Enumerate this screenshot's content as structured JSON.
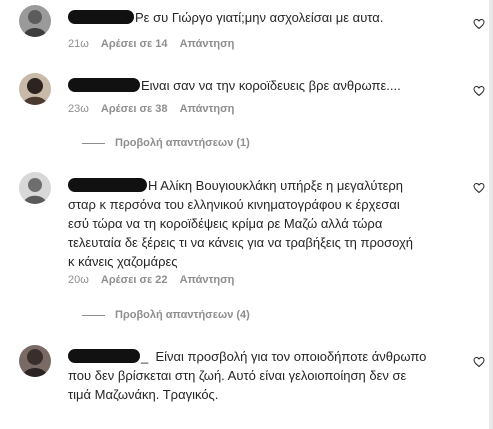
{
  "comments": [
    {
      "text": "Ρε συ Γιώργο γιατί;μην ασχολείσαι με αυτα.",
      "time": "21ω",
      "likes": "Αρέσει σε 14",
      "reply": "Απάντηση"
    },
    {
      "text": "Ειναι σαν να την κοροϊδευεις βρε ανθρωπε....",
      "time": "23ω",
      "likes": "Αρέσει σε 38",
      "reply": "Απάντηση",
      "view_replies": "Προβολή απαντήσεων (1)"
    },
    {
      "line1": "Η Αλίκη Βουγιουκλάκη υπήρξε η μεγαλύτερη",
      "line2": "σταρ κ περσόνα του ελληνικού κινηματογράφου κ έρχεσαι",
      "line3": "εσύ τώρα να τη κοροϊδέψεις κρίμα ρε Μαζώ αλλά τώρα",
      "line4": "τελευταία δε ξέρεις τι να κάνεις για να τραβήξεις τη προσοχή",
      "line5": "κ κάνεις χαζομάρες",
      "time": "20ω",
      "likes": "Αρέσει σε 22",
      "reply": "Απάντηση",
      "view_replies": "Προβολή απαντήσεων (4)"
    },
    {
      "prefix": "_",
      "line1": "Είναι προσβολή για τον οποιοδήποτε άνθρωπο",
      "line2": "που δεν βρίσκεται στη ζωή. Αυτό είναι γελοιοποίηση δεν σε",
      "line3": "τιμά Μαζωνάκη. Τραγικός."
    }
  ],
  "icons": {
    "like": "heart-outline-icon"
  },
  "colors": {
    "text": "#262626",
    "meta": "#8e8e8e",
    "redaction": "#111111"
  }
}
